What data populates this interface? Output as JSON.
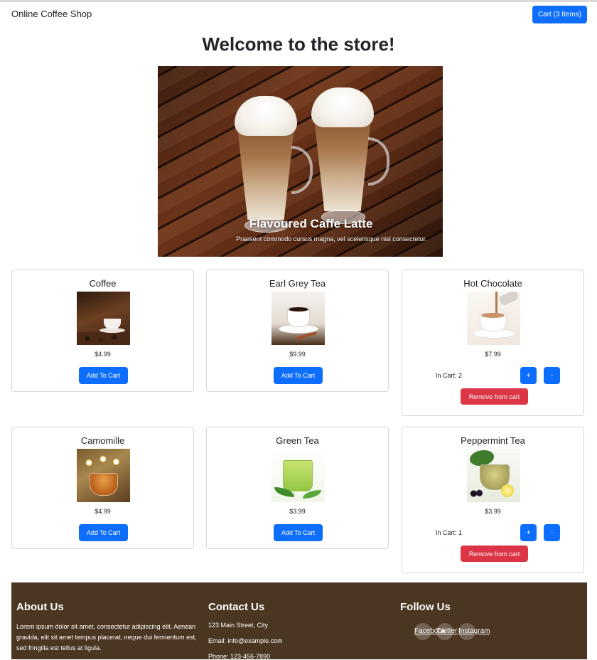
{
  "navbar": {
    "brand": "Online Coffee Shop",
    "cart_label": "Cart (3 Items)"
  },
  "page": {
    "title": "Welcome to the store!"
  },
  "carousel": {
    "caption_title": "Flavoured Caffe Latte",
    "caption_text": "Praesent commodo cursus magna, vel scelerisque nisl consectetur."
  },
  "products": [
    {
      "name": "Coffee",
      "price": "$4.99",
      "add_label": "Add To Cart"
    },
    {
      "name": "Earl Grey Tea",
      "price": "$9.99",
      "add_label": "Add To Cart"
    },
    {
      "name": "Hot Chocolate",
      "price": "$7.99",
      "in_cart": "In Cart: 2",
      "plus_label": "+",
      "minus_label": "-",
      "remove_label": "Remove from cart"
    },
    {
      "name": "Camomille",
      "price": "$4.99",
      "add_label": "Add To Cart"
    },
    {
      "name": "Green Tea",
      "price": "$3.99",
      "add_label": "Add To Cart"
    },
    {
      "name": "Peppermint Tea",
      "price": "$3.99",
      "in_cart": "In Cart: 1",
      "plus_label": "+",
      "minus_label": "-",
      "remove_label": "Remove from cart"
    }
  ],
  "footer": {
    "about": {
      "heading": "About Us",
      "text": "Lorem ipsum dolor sit amet, consectetur adipiscing elit. Aenean gravida, elit sit amet tempus placerat, neque dui fermentum est, sed fringilla est tellus at ligula."
    },
    "contact": {
      "heading": "Contact Us",
      "address": "123 Main Street, City",
      "email": "Email: info@example.com",
      "phone": "Phone: 123-456-7890"
    },
    "follow": {
      "heading": "Follow Us",
      "links": [
        "Facebook",
        "Twitter",
        "Instagram"
      ]
    }
  },
  "colors": {
    "primary": "#0d6efd",
    "danger": "#dc3545",
    "footer_bg": "#4b3621"
  }
}
